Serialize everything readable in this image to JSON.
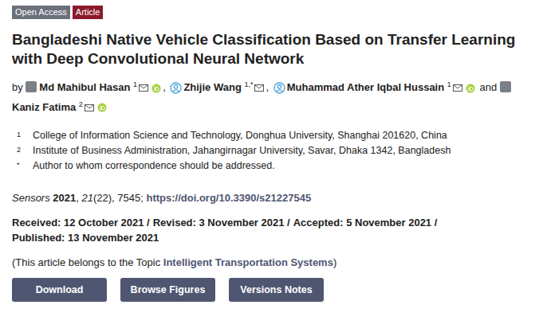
{
  "badges": [
    {
      "label": "Open Access",
      "color": "#6c707c"
    },
    {
      "label": "Article",
      "color": "#8b1a2c"
    }
  ],
  "title": "Bangladeshi Native Vehicle Classification Based on Transfer Learning with Deep Convolutional Neural Network",
  "authors_prefix": "by",
  "authors": [
    {
      "name": "Md Mahibul Hasan",
      "sup": "1",
      "avatar": "photo",
      "orcid": true,
      "sep": ","
    },
    {
      "name": "Zhijie Wang",
      "sup": "1,*",
      "avatar": "placeholder",
      "orcid": false,
      "sep": ","
    },
    {
      "name": "Muhammad Ather Iqbal Hussain",
      "sup": "1",
      "avatar": "placeholder",
      "orcid": true,
      "sep": "and"
    },
    {
      "name": "Kaniz Fatima",
      "sup": "2",
      "avatar": "photo",
      "orcid": true,
      "sep": ""
    }
  ],
  "affiliations": [
    {
      "sup": "1",
      "text": "College of Information Science and Technology, Donghua University, Shanghai 201620, China"
    },
    {
      "sup": "2",
      "text": "Institute of Business Administration, Jahangirnagar University, Savar, Dhaka 1342, Bangladesh"
    },
    {
      "sup": "*",
      "text": "Author to whom correspondence should be addressed."
    }
  ],
  "citation": [
    {
      "text": "Sensors",
      "kind": "italic"
    },
    {
      "text": " 2021",
      "kind": "bold"
    },
    {
      "text": ", ",
      "kind": "plain"
    },
    {
      "text": "21",
      "kind": "italic"
    },
    {
      "text": "(22), 7545; ",
      "kind": "plain"
    },
    {
      "text": "https://doi.org/10.3390/s21227545",
      "kind": "link"
    }
  ],
  "dates": [
    "Received: 12 October 2021 /",
    "Revised: 3 November 2021 /",
    "Accepted: 5 November 2021 /",
    "Published: 13 November 2021"
  ],
  "topic": {
    "prefix": "(This article belongs to the Topic ",
    "link": "Intelligent Transportation Systems",
    "suffix": ")"
  },
  "buttons": [
    "Download",
    "Browse Figures",
    "Versions Notes"
  ]
}
